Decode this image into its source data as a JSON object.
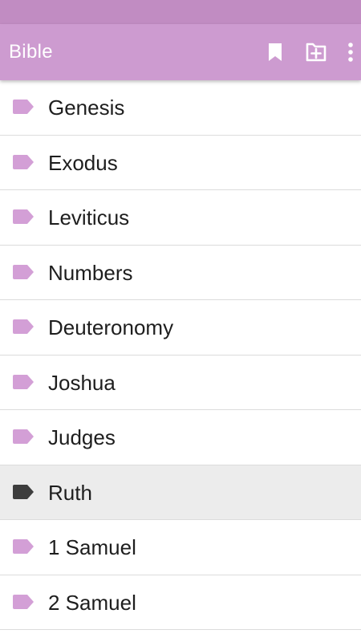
{
  "colors": {
    "status_bar": "#c18cc2",
    "app_bar": "#cd9bd0",
    "tag_default": "#d39fd6",
    "tag_selected": "#3d3d3d",
    "selected_row_bg": "#ececec"
  },
  "app_bar": {
    "title": "Bible",
    "actions": [
      {
        "icon": "bookmark-icon"
      },
      {
        "icon": "add-bookmark-icon"
      },
      {
        "icon": "more-vert-icon"
      }
    ]
  },
  "books": [
    {
      "label": "Genesis",
      "selected": false
    },
    {
      "label": "Exodus",
      "selected": false
    },
    {
      "label": "Leviticus",
      "selected": false
    },
    {
      "label": "Numbers",
      "selected": false
    },
    {
      "label": "Deuteronomy",
      "selected": false
    },
    {
      "label": "Joshua",
      "selected": false
    },
    {
      "label": "Judges",
      "selected": false
    },
    {
      "label": "Ruth",
      "selected": true
    },
    {
      "label": "1 Samuel",
      "selected": false
    },
    {
      "label": "2 Samuel",
      "selected": false
    }
  ]
}
